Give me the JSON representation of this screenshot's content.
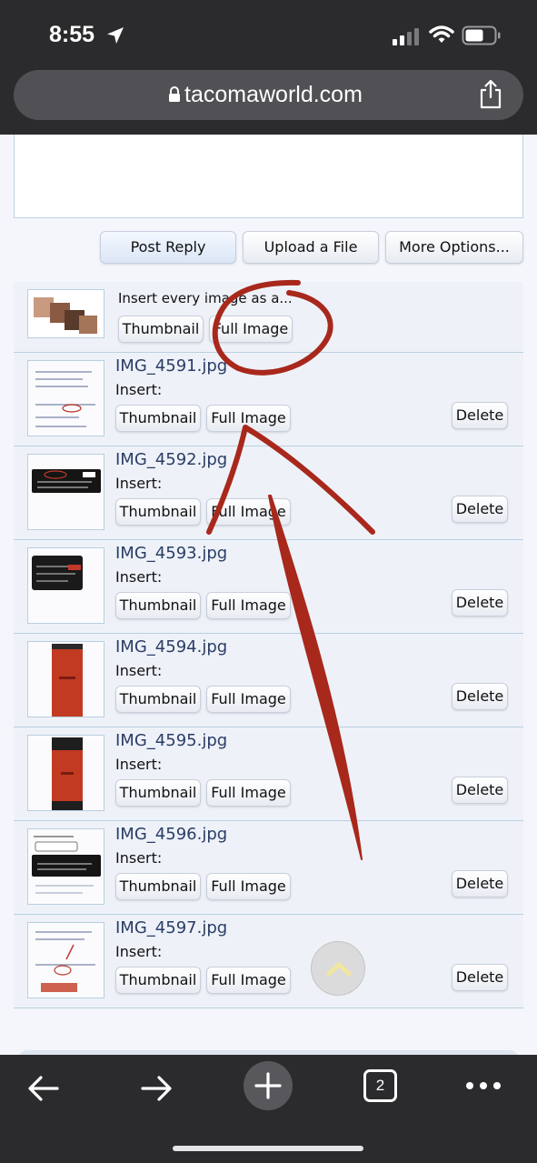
{
  "status": {
    "time": "8:55"
  },
  "browser": {
    "url": "tacomaworld.com",
    "tabs_count": "2"
  },
  "reply_toolbar": {
    "post_reply": "Post Reply",
    "upload_file": "Upload a File",
    "more_options": "More Options..."
  },
  "insert_all": {
    "label": "Insert every image as a...",
    "thumbnail": "Thumbnail",
    "full_image": "Full Image"
  },
  "attachments": [
    {
      "filename": "IMG_4591.jpg",
      "insert": "Insert:",
      "thumbnail": "Thumbnail",
      "full_image": "Full Image",
      "delete": "Delete"
    },
    {
      "filename": "IMG_4592.jpg",
      "insert": "Insert:",
      "thumbnail": "Thumbnail",
      "full_image": "Full Image",
      "delete": "Delete"
    },
    {
      "filename": "IMG_4593.jpg",
      "insert": "Insert:",
      "thumbnail": "Thumbnail",
      "full_image": "Full Image",
      "delete": "Delete"
    },
    {
      "filename": "IMG_4594.jpg",
      "insert": "Insert:",
      "thumbnail": "Thumbnail",
      "full_image": "Full Image",
      "delete": "Delete"
    },
    {
      "filename": "IMG_4595.jpg",
      "insert": "Insert:",
      "thumbnail": "Thumbnail",
      "full_image": "Full Image",
      "delete": "Delete"
    },
    {
      "filename": "IMG_4596.jpg",
      "insert": "Insert:",
      "thumbnail": "Thumbnail",
      "full_image": "Full Image",
      "delete": "Delete"
    },
    {
      "filename": "IMG_4597.jpg",
      "insert": "Insert:",
      "thumbnail": "Thumbnail",
      "full_image": "Full Image",
      "delete": "Delete"
    }
  ],
  "colors": {
    "chrome_dark": "#2b2b2d",
    "url_pill": "#515155",
    "row_bg": "#eef2f8",
    "border_blue": "#b9cfe0",
    "filename_blue": "#2a3d66",
    "annotation_red": "#a8281c"
  },
  "icons": {
    "location": "location-arrow-icon",
    "signal": "cellular-signal-icon",
    "wifi": "wifi-icon",
    "battery": "battery-icon",
    "lock": "lock-icon",
    "share": "share-icon",
    "back": "back-arrow-icon",
    "forward": "forward-arrow-icon",
    "new_tab": "plus-icon",
    "tabs": "tabs-icon",
    "more": "more-dots-icon",
    "scroll_top": "chevron-up-icon"
  }
}
